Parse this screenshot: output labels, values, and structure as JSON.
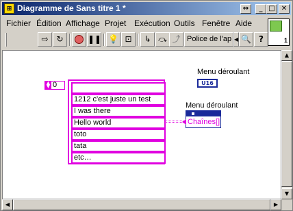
{
  "window": {
    "title": "Diagramme de Sans titre 1 *",
    "buttons": {
      "restore": "↔",
      "minimize": "_",
      "maximize": "□",
      "close": "✕"
    }
  },
  "menu": [
    "Fichier",
    "Édition",
    "Affichage",
    "Projet",
    "Exécution",
    "Outils",
    "Fenêtre",
    "Aide"
  ],
  "toolbar": {
    "font_selector": "Police de l'ap",
    "icons": [
      "run-arrow-icon",
      "run-continuously-icon",
      "abort-icon",
      "pause-icon",
      "highlight-execution-icon",
      "retain-wire-values-icon",
      "step-into-icon",
      "step-over-icon",
      "step-out-icon",
      "font-dropdown-arrow-icon",
      "search-icon",
      "help-icon"
    ]
  },
  "vi_icon": {
    "label": "1"
  },
  "diagram": {
    "array_index": "0",
    "array_items": [
      "",
      "1212 c'est juste un test",
      "I was there",
      "Hello world",
      "toto",
      "tata",
      "etc…"
    ],
    "terminal1_label": "Menu déroulant",
    "terminal1_type": "U16",
    "terminal2_label": "Menu déroulant",
    "terminal2_text": "Chaînes[]"
  },
  "colors": {
    "accent": "#e000e0",
    "terminal": "#1a2a9a"
  }
}
